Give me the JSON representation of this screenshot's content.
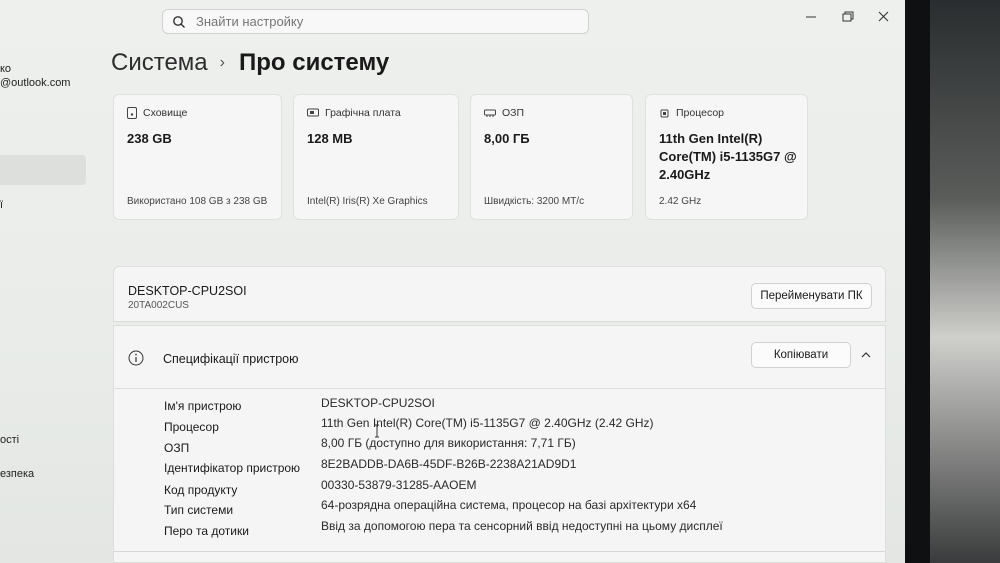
{
  "search": {
    "placeholder": "Знайти настройку"
  },
  "sidebar": {
    "user_name_fragment": "ко",
    "user_email_fragment": "@outlook.com",
    "item_fragment_1": "ї",
    "item_fragment_2": "ості",
    "item_fragment_3": "езпека"
  },
  "breadcrumb": {
    "parent": "Система",
    "separator": "›",
    "current": "Про систему"
  },
  "cards": [
    {
      "label": "Сховище",
      "value_lines": [
        "238 GB"
      ],
      "detail": "Використано 108 GB з 238 GB",
      "icon": "storage-icon"
    },
    {
      "label": "Графічна плата",
      "value_lines": [
        "128 MB"
      ],
      "detail": "Intel(R) Iris(R) Xe Graphics",
      "icon": "gpu-icon"
    },
    {
      "label": "ОЗП",
      "value_lines": [
        "8,00 ГБ"
      ],
      "detail": "Швидкість: 3200 MT/с",
      "icon": "ram-icon"
    },
    {
      "label": "Процесор",
      "value_lines": [
        "11th Gen Intel(R)",
        "Core(TM) i5-1135G7 @",
        "2.40GHz"
      ],
      "detail": "2.42 GHz",
      "icon": "cpu-icon"
    }
  ],
  "device": {
    "name": "DESKTOP-CPU2SOI",
    "model": "20TA002CUS",
    "rename_label": "Перейменувати ПК"
  },
  "specs": {
    "title": "Специфікації пристрою",
    "copy_label": "Копіювати",
    "rows": [
      {
        "label": "Ім'я пристрою",
        "value": "DESKTOP-CPU2SOI"
      },
      {
        "label": "Процесор",
        "value": "11th Gen Intel(R) Core(TM) i5-1135G7 @ 2.40GHz (2.42 GHz)"
      },
      {
        "label": "ОЗП",
        "value": "8,00 ГБ (доступно для використання: 7,71 ГБ)"
      },
      {
        "label": "Ідентифікатор пристрою",
        "value": "8E2BADDB-DA6B-45DF-B26B-2238A21AD9D1"
      },
      {
        "label": "Код продукту",
        "value": "00330-53879-31285-AAOEM"
      },
      {
        "label": "Тип системи",
        "value": "64-розрядна операційна система, процесор на базі архітектури x64"
      },
      {
        "label": "Перо та дотики",
        "value": "Ввід за допомогою пера та сенсорний ввід недоступні на цьому дисплеї"
      }
    ]
  }
}
